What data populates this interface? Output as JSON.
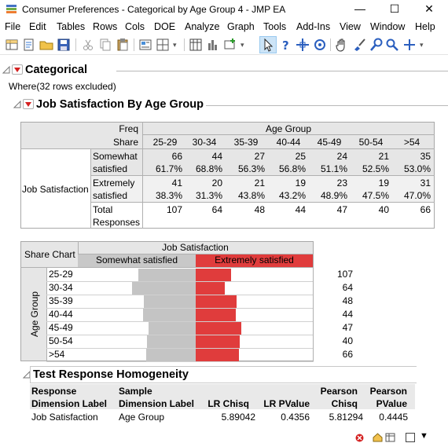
{
  "window": {
    "title": "Consumer Preferences - Categorical by Age Group 4 - JMP EA",
    "minimize": "—",
    "maximize": "☐",
    "close": "✕"
  },
  "menu": [
    "File",
    "Edit",
    "Tables",
    "Rows",
    "Cols",
    "DOE",
    "Analyze",
    "Graph",
    "Tools",
    "Add-Ins",
    "View",
    "Window",
    "Help"
  ],
  "report": {
    "title": "Categorical",
    "where": "Where(32 rows excluded)",
    "section_title": "Job Satisfaction By Age Group"
  },
  "freq_table": {
    "freq_label": "Freq",
    "share_label": "Share",
    "group_header": "Age Group",
    "row_header": "Job Satisfaction",
    "columns": [
      "25-29",
      "30-34",
      "35-39",
      "40-44",
      "45-49",
      "50-54",
      ">54"
    ],
    "rows": [
      {
        "label1": "Somewhat",
        "label2": "satisfied",
        "freq": [
          "66",
          "44",
          "27",
          "25",
          "24",
          "21",
          "35"
        ],
        "share": [
          "61.7%",
          "68.8%",
          "56.3%",
          "56.8%",
          "51.1%",
          "52.5%",
          "53.0%"
        ]
      },
      {
        "label1": "Extremely",
        "label2": "satisfied",
        "freq": [
          "41",
          "20",
          "21",
          "19",
          "23",
          "19",
          "31"
        ],
        "share": [
          "38.3%",
          "31.3%",
          "43.8%",
          "43.2%",
          "48.9%",
          "47.5%",
          "47.0%"
        ]
      }
    ],
    "total": {
      "label1": "Total",
      "label2": "Responses",
      "values": [
        "107",
        "64",
        "48",
        "44",
        "47",
        "40",
        "66"
      ]
    }
  },
  "share_chart": {
    "corner_label": "Share Chart",
    "header": "Job Satisfaction",
    "legend": [
      "Somewhat satisfied",
      "Extremely satisfied"
    ],
    "y_label": "Age Group",
    "colors": {
      "somewhat": "#c4c4c4",
      "extremely": "#e03c3c",
      "legend_somewhat": "#c8c8c8",
      "legend_extremely": "#e03c3c"
    }
  },
  "chart_data": {
    "type": "bar",
    "stacked": "percent",
    "orientation": "horizontal",
    "categories": [
      "25-29",
      "30-34",
      "35-39",
      "40-44",
      "45-49",
      "50-54",
      ">54"
    ],
    "series": [
      {
        "name": "Somewhat satisfied",
        "values": [
          61.7,
          68.8,
          56.3,
          56.8,
          51.1,
          52.5,
          53.0
        ]
      },
      {
        "name": "Extremely satisfied",
        "values": [
          38.3,
          31.3,
          43.8,
          43.2,
          48.9,
          47.5,
          47.0
        ]
      }
    ],
    "totals": [
      "107",
      "64",
      "48",
      "44",
      "47",
      "40",
      "66"
    ],
    "ylabel": "Age Group",
    "title": "Job Satisfaction"
  },
  "homogeneity": {
    "title": "Test Response Homogeneity",
    "headers": [
      [
        "Response",
        "Dimension Label"
      ],
      [
        "Sample",
        "Dimension Label"
      ],
      [
        "",
        "LR Chisq"
      ],
      [
        "",
        "LR PValue"
      ],
      [
        "Pearson",
        "Chisq"
      ],
      [
        "Pearson",
        "PValue"
      ]
    ],
    "row": [
      "Job Satisfaction",
      "Age Group",
      "5.89042",
      "0.4356",
      "5.81294",
      "0.4445"
    ]
  }
}
